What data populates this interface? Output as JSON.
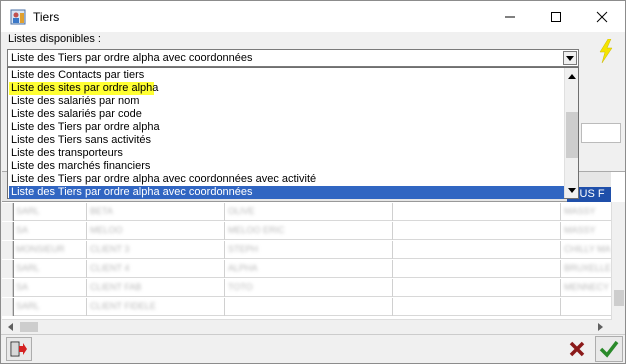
{
  "window": {
    "title": "Tiers",
    "controls": {
      "minimize": "—",
      "maximize": "☐",
      "close": "✕"
    },
    "icon": "tiers-app-icon"
  },
  "form": {
    "listes_label": "Listes disponibles :",
    "combo_value": "Liste des Tiers par ordre alpha avec coordonnées",
    "action_icon": "lightning-icon",
    "action_color": "#f5e400"
  },
  "dropdown": {
    "items": [
      "Liste des Contacts par tiers",
      "Liste des sites par ordre alpha",
      "Liste des salariés par nom",
      "Liste des salariés par code",
      "Liste des Tiers par ordre alpha",
      "Liste des Tiers sans activités",
      "Liste des transporteurs",
      "Liste des marchés financiers",
      "Liste des Tiers par ordre alpha avec coordonnées avec activité",
      "Liste des Tiers par ordre alpha avec coordonnées"
    ],
    "highlighted_index": 1,
    "selected_index": 9,
    "highlight_color": "#ffff32",
    "selected_color": "#3166c2"
  },
  "grid": {
    "header_fragment": "OUS F",
    "rows": [
      [
        "SARL",
        "BETA",
        "OLIVE",
        "",
        "MASSY"
      ],
      [
        "SA",
        "MELOO",
        "MELOO ERIC",
        "",
        "MASSY"
      ],
      [
        "MONSIEUR",
        "CLIENT 3",
        "STEPH",
        "",
        "CHILLY MAZ"
      ],
      [
        "SARL",
        "CLIENT 4",
        "ALPHA",
        "",
        "BRUXELLES"
      ],
      [
        "SA",
        "CLIENT FAB",
        "TOTO",
        "",
        "MENNECY"
      ],
      [
        "SARL",
        "CLIENT FIDELE",
        "",
        "",
        ""
      ]
    ]
  },
  "footer": {
    "exit_icon": "exit-door-icon",
    "cancel_icon": "cancel-x-icon",
    "ok_icon": "ok-check-icon"
  }
}
